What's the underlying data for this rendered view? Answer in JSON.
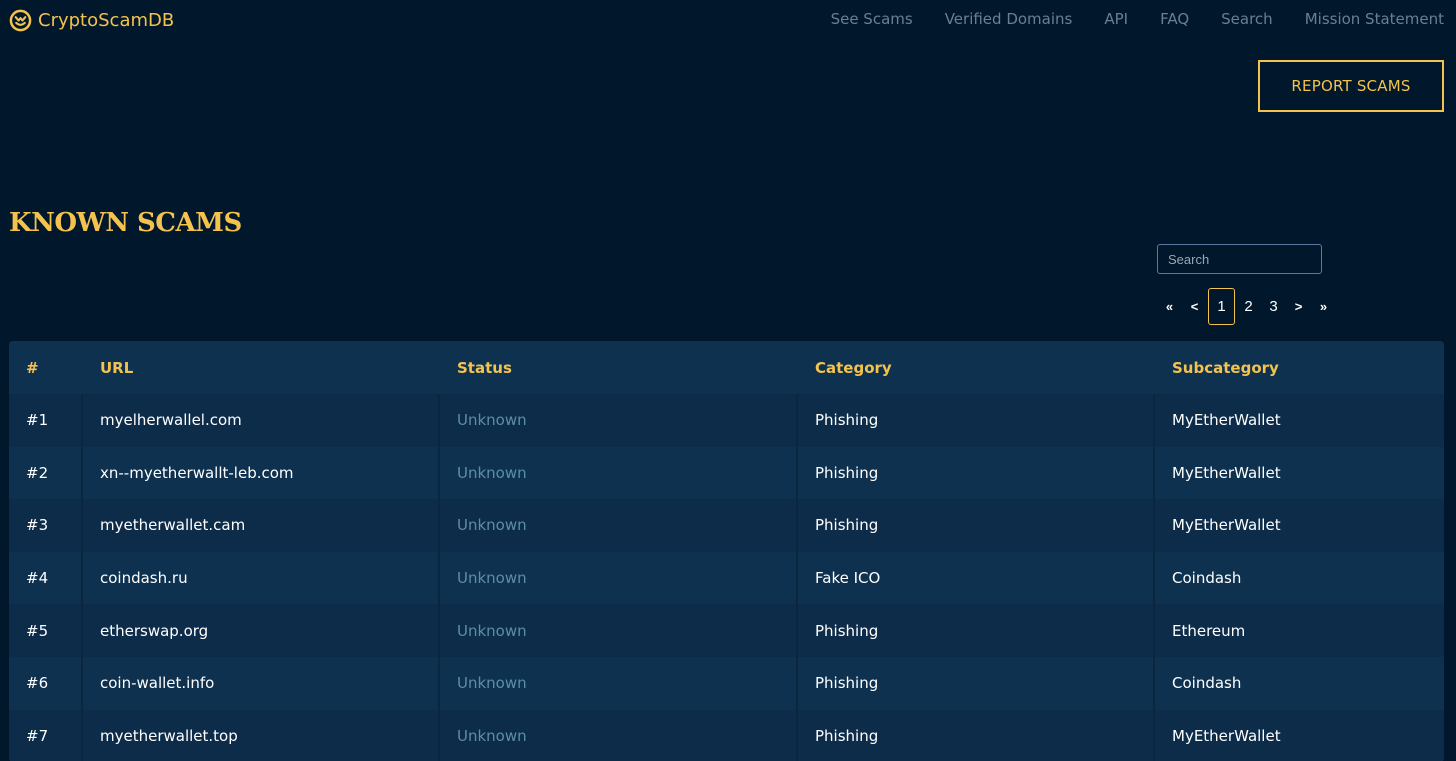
{
  "brand": {
    "name": "CryptoScamDB",
    "icon": "smiley-coin-icon",
    "color": "#f3c34d"
  },
  "nav": [
    {
      "label": "See Scams"
    },
    {
      "label": "Verified Domains"
    },
    {
      "label": "API"
    },
    {
      "label": "FAQ"
    },
    {
      "label": "Search"
    },
    {
      "label": "Mission Statement"
    }
  ],
  "report_button": "REPORT SCAMS",
  "page_title": "KNOWN SCAMS",
  "search": {
    "placeholder": "Search",
    "value": ""
  },
  "pager": {
    "first": "«",
    "prev": "<",
    "pages": [
      "1",
      "2",
      "3"
    ],
    "active_page": "1",
    "next": ">",
    "last": "»"
  },
  "table": {
    "headers": [
      "#",
      "URL",
      "Status",
      "Category",
      "Subcategory"
    ],
    "rows": [
      {
        "idx": "#1",
        "url": "myelherwallel.com",
        "status": "Unknown",
        "category": "Phishing",
        "subcategory": "MyEtherWallet"
      },
      {
        "idx": "#2",
        "url": "xn--myetherwallt-leb.com",
        "status": "Unknown",
        "category": "Phishing",
        "subcategory": "MyEtherWallet"
      },
      {
        "idx": "#3",
        "url": "myetherwallet.cam",
        "status": "Unknown",
        "category": "Phishing",
        "subcategory": "MyEtherWallet"
      },
      {
        "idx": "#4",
        "url": "coindash.ru",
        "status": "Unknown",
        "category": "Fake ICO",
        "subcategory": "Coindash"
      },
      {
        "idx": "#5",
        "url": "etherswap.org",
        "status": "Unknown",
        "category": "Phishing",
        "subcategory": "Ethereum"
      },
      {
        "idx": "#6",
        "url": "coin-wallet.info",
        "status": "Unknown",
        "category": "Phishing",
        "subcategory": "Coindash"
      },
      {
        "idx": "#7",
        "url": "myetherwallet.top",
        "status": "Unknown",
        "category": "Phishing",
        "subcategory": "MyEtherWallet"
      }
    ]
  },
  "colors": {
    "accent": "#f3c34d",
    "background": "#00172c",
    "table_row": "#0e3150",
    "status_text": "#5b8fa8",
    "nav_text": "#6c7f91"
  }
}
